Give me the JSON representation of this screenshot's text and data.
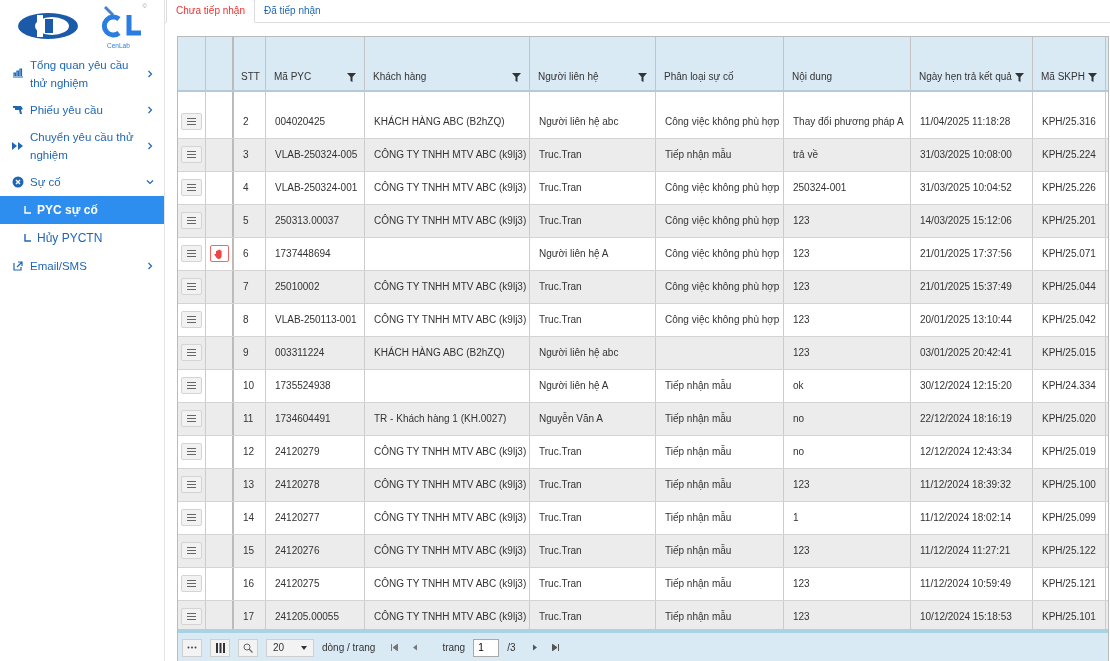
{
  "logos": {
    "cenlab_text": "CenLab",
    "copyright": "©"
  },
  "sidebar": {
    "items": [
      {
        "label": "Tổng quan yêu cầu thử nghiệm",
        "expanded": false
      },
      {
        "label": "Phiếu yêu cầu",
        "expanded": false
      },
      {
        "label": "Chuyển yêu cầu thử nghiệm",
        "expanded": false
      },
      {
        "label": "Sự cố",
        "expanded": true,
        "children": [
          {
            "label": "PYC sự cố",
            "selected": true
          },
          {
            "label": "Hủy PYCTN",
            "selected": false
          }
        ]
      },
      {
        "label": "Email/SMS",
        "expanded": false
      }
    ]
  },
  "tabs": [
    {
      "label": "Chưa tiếp nhận",
      "selected": true
    },
    {
      "label": "Đã tiếp nhận",
      "selected": false
    }
  ],
  "table": {
    "columns": [
      {
        "label": "STT",
        "filterable": false
      },
      {
        "label": "Mã PYC",
        "filterable": true
      },
      {
        "label": "Khách hàng",
        "filterable": true
      },
      {
        "label": "Người liên hệ",
        "filterable": true
      },
      {
        "label": "Phân loại sự cố",
        "filterable": false
      },
      {
        "label": "Nội dung",
        "filterable": false
      },
      {
        "label": "Ngày hẹn trả kết quả",
        "filterable": true
      },
      {
        "label": "Mã SKPH",
        "filterable": true
      }
    ],
    "rows": [
      {
        "flagged": false,
        "cells": [
          "2",
          "004020425",
          "KHÁCH HÀNG ABC (B2hZQ)",
          "Người liên hệ abc",
          "Công việc không phù hợp",
          "Thay đổi phương pháp A",
          "11/04/2025 11:18:28",
          "KPH/25.316"
        ]
      },
      {
        "flagged": false,
        "cells": [
          "3",
          "VLAB-250324-005",
          "CÔNG TY TNHH MTV ABC (k9lj3)",
          "Truc.Tran",
          "Tiếp nhận mẫu",
          "trả về",
          "31/03/2025 10:08:00",
          "KPH/25.224"
        ]
      },
      {
        "flagged": false,
        "cells": [
          "4",
          "VLAB-250324-001",
          "CÔNG TY TNHH MTV ABC (k9lj3)",
          "Truc.Tran",
          "Công việc không phù hợp",
          "250324-001",
          "31/03/2025 10:04:52",
          "KPH/25.226"
        ]
      },
      {
        "flagged": false,
        "cells": [
          "5",
          "250313.00037",
          "CÔNG TY TNHH MTV ABC (k9lj3)",
          "Truc.Tran",
          "Công việc không phù hợp",
          "123",
          "14/03/2025 15:12:06",
          "KPH/25.201"
        ]
      },
      {
        "flagged": true,
        "cells": [
          "6",
          "1737448694",
          "",
          "Người liên hệ A",
          "Công việc không phù hợp",
          "123",
          "21/01/2025 17:37:56",
          "KPH/25.071"
        ]
      },
      {
        "flagged": false,
        "cells": [
          "7",
          "25010002",
          "CÔNG TY TNHH MTV ABC (k9lj3)",
          "Truc.Tran",
          "Công việc không phù hợp",
          "123",
          "21/01/2025 15:37:49",
          "KPH/25.044"
        ]
      },
      {
        "flagged": false,
        "cells": [
          "8",
          "VLAB-250113-001",
          "CÔNG TY TNHH MTV ABC (k9lj3)",
          "Truc.Tran",
          "Công việc không phù hợp",
          "123",
          "20/01/2025 13:10:44",
          "KPH/25.042"
        ]
      },
      {
        "flagged": false,
        "cells": [
          "9",
          "003311224",
          "KHÁCH HÀNG ABC (B2hZQ)",
          "Người liên hệ abc",
          "",
          "123",
          "03/01/2025 20:42:41",
          "KPH/25.015"
        ]
      },
      {
        "flagged": false,
        "cells": [
          "10",
          "1735524938",
          "",
          "Người liên hệ A",
          "Tiếp nhận mẫu",
          "ok",
          "30/12/2024 12:15:20",
          "KPH/24.334"
        ]
      },
      {
        "flagged": false,
        "cells": [
          "11",
          "1734604491",
          "TR - Khách hàng 1 (KH.0027)",
          "Nguyễn Văn A",
          "Tiếp nhận mẫu",
          "no",
          "22/12/2024 18:16:19",
          "KPH/25.020"
        ]
      },
      {
        "flagged": false,
        "cells": [
          "12",
          "24120279",
          "CÔNG TY TNHH MTV ABC (k9lj3)",
          "Truc.Tran",
          "Tiếp nhận mẫu",
          "no",
          "12/12/2024 12:43:34",
          "KPH/25.019"
        ]
      },
      {
        "flagged": false,
        "cells": [
          "13",
          "24120278",
          "CÔNG TY TNHH MTV ABC (k9lj3)",
          "Truc.Tran",
          "Tiếp nhận mẫu",
          "123",
          "11/12/2024 18:39:32",
          "KPH/25.100"
        ]
      },
      {
        "flagged": false,
        "cells": [
          "14",
          "24120277",
          "CÔNG TY TNHH MTV ABC (k9lj3)",
          "Truc.Tran",
          "Tiếp nhận mẫu",
          "1",
          "11/12/2024 18:02:14",
          "KPH/25.099"
        ]
      },
      {
        "flagged": false,
        "cells": [
          "15",
          "24120276",
          "CÔNG TY TNHH MTV ABC (k9lj3)",
          "Truc.Tran",
          "Tiếp nhận mẫu",
          "123",
          "11/12/2024 11:27:21",
          "KPH/25.122"
        ]
      },
      {
        "flagged": false,
        "cells": [
          "16",
          "24120275",
          "CÔNG TY TNHH MTV ABC (k9lj3)",
          "Truc.Tran",
          "Tiếp nhận mẫu",
          "123",
          "11/12/2024 10:59:49",
          "KPH/25.121"
        ]
      },
      {
        "flagged": false,
        "cells": [
          "17",
          "241205.00055",
          "CÔNG TY TNHH MTV ABC (k9lj3)",
          "Truc.Tran",
          "Tiếp nhận mẫu",
          "123",
          "10/12/2024 15:18:53",
          "KPH/25.101"
        ]
      }
    ]
  },
  "pager": {
    "page_size": "20",
    "page_size_label": "dòng / trang",
    "page_label": "trang",
    "page": "1",
    "total": "/3"
  }
}
